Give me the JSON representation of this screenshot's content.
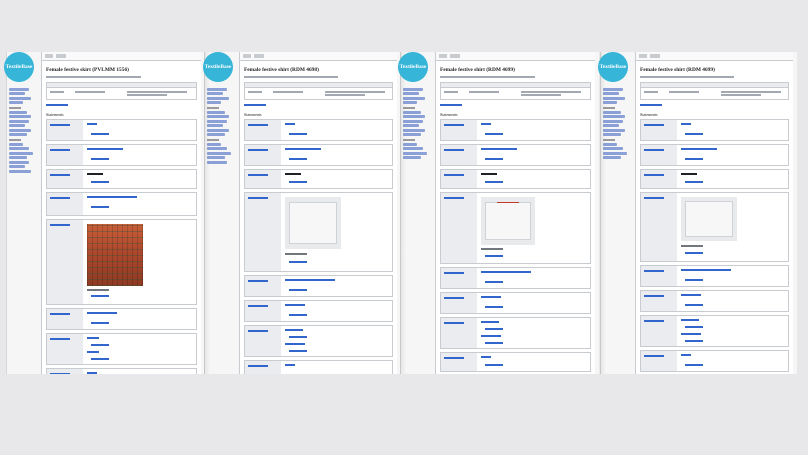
{
  "logo_text": "TextileBase",
  "panels": [
    {
      "title": "Female festive skirt",
      "code": "(PVLMM 1556)",
      "image": "skirt"
    },
    {
      "title": "Female festive shirt",
      "code": "(RDM 4698)",
      "image": "shirt"
    },
    {
      "title": "Female festive shirt",
      "code": "(RDM 4699)",
      "image": "shirt-red"
    },
    {
      "title": "Female festive shirt",
      "code": "(RDM 4699)",
      "image": "shirt"
    }
  ],
  "section_label": "Statements",
  "colors": {
    "logo": "#36b5d8",
    "link": "#3366cc",
    "background": "#e8e8ea"
  }
}
